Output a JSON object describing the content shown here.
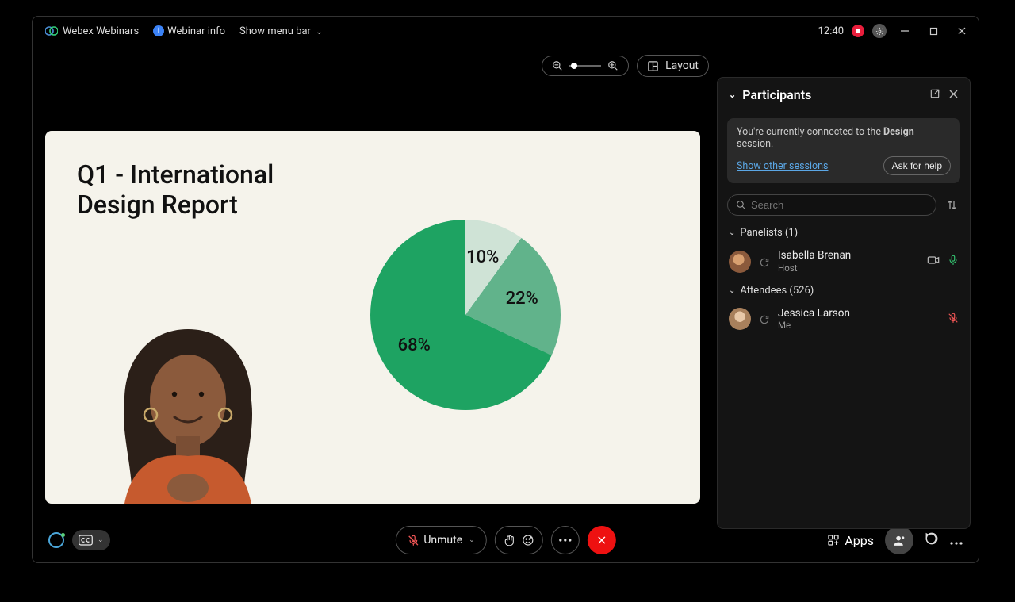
{
  "titlebar": {
    "app_name": "Webex Webinars",
    "webinar_info": "Webinar info",
    "show_menu": "Show menu bar",
    "clock": "12:40"
  },
  "view": {
    "layout_label": "Layout"
  },
  "slide": {
    "title": "Q1 -  International\nDesign Report"
  },
  "chart_data": {
    "type": "pie",
    "values": [
      68,
      22,
      10
    ],
    "labels": [
      "68%",
      "22%",
      "10%"
    ],
    "colors": [
      "#1ea362",
      "#61b38b",
      "#cfe3d6"
    ]
  },
  "panel": {
    "title": "Participants",
    "notice_prefix": "You're currently connected to the ",
    "notice_session_name": "Design",
    "notice_suffix": " session.",
    "show_sessions": "Show other sessions",
    "ask_help": "Ask for help",
    "search_placeholder": "Search",
    "groups": {
      "panelists_label": "Panelists (1)",
      "attendees_label": "Attendees (526)"
    },
    "panelists": [
      {
        "name": "Isabella Brenan",
        "role": "Host",
        "camera": true,
        "mic_on": true
      }
    ],
    "attendees": [
      {
        "name": "Jessica Larson",
        "role": "Me",
        "mic_muted": true
      }
    ]
  },
  "bottombar": {
    "unmute": "Unmute",
    "apps": "Apps"
  }
}
